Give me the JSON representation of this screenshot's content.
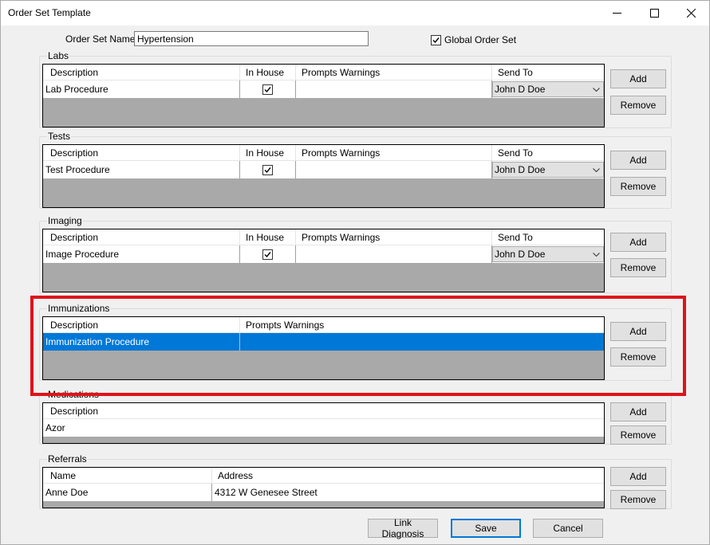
{
  "window": {
    "title": "Order Set Template",
    "minimize_glyph": "minimize-icon",
    "maximize_glyph": "maximize-icon",
    "close_glyph": "close-icon"
  },
  "header": {
    "name_label": "Order Set Name",
    "name_value": "Hypertension",
    "global_label": "Global Order Set",
    "global_checked": true
  },
  "labs": {
    "title": "Labs",
    "columns": [
      "Description",
      "In House",
      "Prompts Warnings",
      "Send To"
    ],
    "row": {
      "description": "Lab Procedure",
      "in_house": true,
      "prompts": "",
      "send_to": "John D Doe"
    },
    "add": "Add",
    "remove": "Remove"
  },
  "tests": {
    "title": "Tests",
    "columns": [
      "Description",
      "In House",
      "Prompts Warnings",
      "Send To"
    ],
    "row": {
      "description": "Test Procedure",
      "in_house": true,
      "prompts": "",
      "send_to": "John D Doe"
    },
    "add": "Add",
    "remove": "Remove"
  },
  "imaging": {
    "title": "Imaging",
    "columns": [
      "Description",
      "In House",
      "Prompts Warnings",
      "Send To"
    ],
    "row": {
      "description": "Image Procedure",
      "in_house": true,
      "prompts": "",
      "send_to": "John D Doe"
    },
    "add": "Add",
    "remove": "Remove"
  },
  "immunizations": {
    "title": "Immunizations",
    "columns": [
      "Description",
      "Prompts Warnings"
    ],
    "row": {
      "description": "Immunization Procedure",
      "prompts": ""
    },
    "add": "Add",
    "remove": "Remove"
  },
  "medications": {
    "title": "Medications",
    "columns": [
      "Description"
    ],
    "row": {
      "description": "Azor"
    },
    "add": "Add",
    "remove": "Remove"
  },
  "referrals": {
    "title": "Referrals",
    "columns": [
      "Name",
      "Address"
    ],
    "row": {
      "name": "Anne Doe",
      "address": "4312 W Genesee Street"
    },
    "add": "Add",
    "remove": "Remove"
  },
  "footer": {
    "link_diagnosis": "Link Diagnosis",
    "save": "Save",
    "cancel": "Cancel"
  },
  "colors": {
    "selection": "#0078d7",
    "highlight_box": "#e0121a",
    "grid_empty": "#a9a9a9"
  }
}
